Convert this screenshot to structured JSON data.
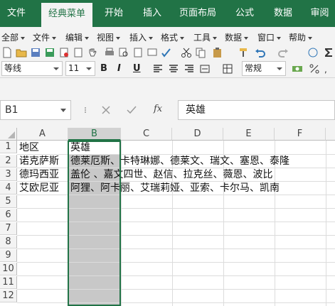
{
  "ribbon": {
    "tabs": [
      "文件",
      "经典菜单",
      "开始",
      "插入",
      "页面布局",
      "公式",
      "数据",
      "审阅"
    ],
    "active_index": 1,
    "accent": "#217346"
  },
  "menu_bar": {
    "items": [
      "全部",
      "文件",
      "编辑",
      "视图",
      "插入",
      "格式",
      "工具",
      "数据",
      "窗口",
      "帮助"
    ]
  },
  "format_bar": {
    "font_name": "等线",
    "font_size": "11",
    "bold": "B",
    "italic": "I",
    "underline": "U",
    "number_format": "常规"
  },
  "formula_bar": {
    "name_box": "B1",
    "fx_label": "fx",
    "formula_value": "英雄"
  },
  "sheet": {
    "columns": [
      "A",
      "B",
      "C",
      "D",
      "E",
      "F"
    ],
    "selected_column": "B",
    "rows": [
      "1",
      "2",
      "3",
      "4",
      "5",
      "6",
      "7",
      "8",
      "9",
      "10",
      "11",
      "12"
    ],
    "cells": {
      "A1": "地区",
      "B1": "英雄",
      "A2": "诺克萨斯",
      "B2": "德莱厄斯、卡特琳娜、德莱文、瑞文、塞恩、泰隆",
      "A3": "德玛西亚",
      "B3": "盖伦 、嘉文四世、赵信、拉克丝、薇恩、波比",
      "A4": "艾欧尼亚",
      "B4": "阿狸、阿卡丽、艾瑞莉娅、亚索、卡尔马、凯南"
    }
  }
}
